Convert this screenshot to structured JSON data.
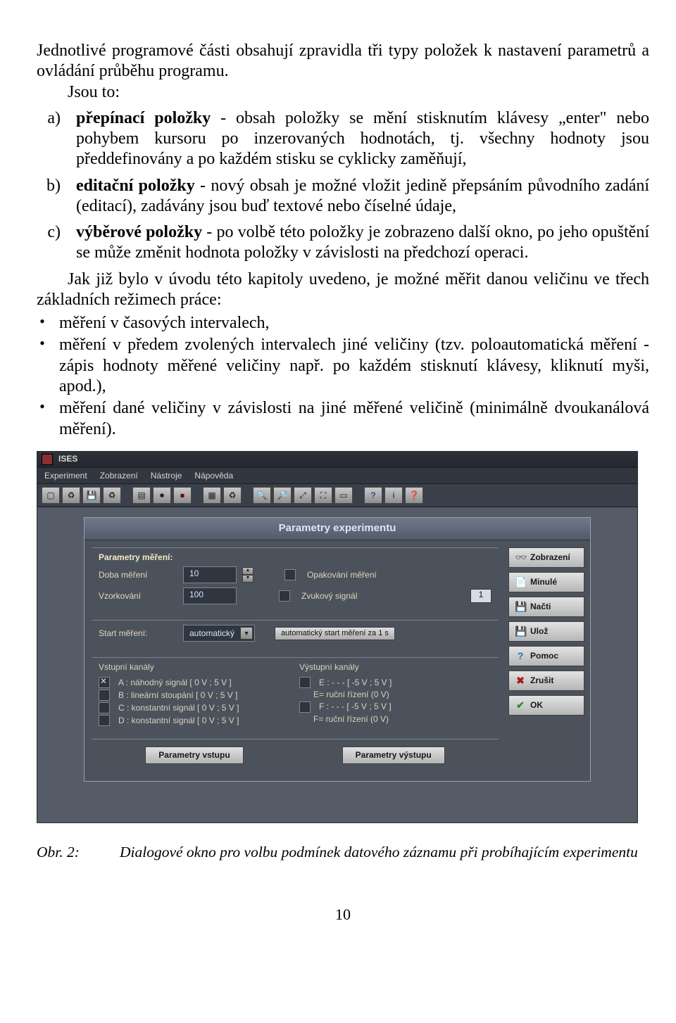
{
  "text": {
    "intro": "Jednotlivé programové části obsahují zpravidla tři typy položek k nastavení parametrů a ovládání průběhu programu.",
    "jsou_to": "Jsou to:",
    "items": [
      {
        "lbl": "a)",
        "pre": "přepínací položky",
        "post": " - obsah položky se mění stisknutím  klávesy „enter\" nebo pohybem kursoru po inzerovaných  hodnotách, tj. všechny hodnoty jsou předdefinovány a po  každém stisku se cyklicky zaměňují,"
      },
      {
        "lbl": "b)",
        "pre": "editační položky",
        "post": " - nový obsah je možné vložit jedině  přepsáním původního zadání (editací), zadávány jsou buď  textové nebo číselné údaje,"
      },
      {
        "lbl": "c)",
        "pre": "výběrové položky",
        "post": " - po volbě této položky je zobrazeno  další okno, po jeho opuštění se může změnit hodnota položky v závislosti na předchozí operaci."
      }
    ],
    "after": "Jak již bylo v úvodu této kapitoly uvedeno, je  možné měřit danou veličinu ve třech základních režimech práce:",
    "bul1": "měření v časových intervalech,",
    "bul2": "měření v předem zvolených intervalech jiné veličiny (tzv. poloautomatická měření - zápis hodnoty měřené veličiny např. po každém stisknutí klávesy, kliknutí myši, apod.),",
    "bul3": "měření dané veličiny v závislosti na jiné měřené veličině (minimálně dvoukanálová měření)."
  },
  "shot": {
    "title": "ISES",
    "menu": [
      "Experiment",
      "Zobrazení",
      "Nástroje",
      "Nápověda"
    ],
    "dlg_title": "Parametry experimentu",
    "grp1_title": "Parametry měření:",
    "doba_lbl": "Doba měření",
    "doba_val": "10",
    "vz_lbl": "Vzorkování",
    "vz_val": "100",
    "opak": "Opakování měření",
    "zvuk": "Zvukový signál",
    "count_val": "1",
    "start_lbl": "Start měření:",
    "start_val": "automatický",
    "start_info": "automatický start měření za 1 s",
    "in_title": "Vstupní kanály",
    "out_title": "Výstupní kanály",
    "in": [
      "A : náhodný signál [ 0 V ; 5 V ]",
      "B : lineární stoupání [ 0 V ; 5 V ]",
      "C : konstantní signál [ 0 V ; 5 V ]",
      "D : konstantní signál [ 0 V ; 5 V ]"
    ],
    "out": [
      "E : - - -  [ -5 V ; 5 V ]",
      "E= ruční řízení (0 V)",
      "F : - - -  [ -5 V ; 5 V ]",
      "F= ruční řízení (0 V)"
    ],
    "btn_in": "Parametry vstupu",
    "btn_out": "Parametry výstupu",
    "right": [
      "Zobrazení",
      "Minulé",
      "Načti",
      "Ulož",
      "Pomoc",
      "Zrušit",
      "OK"
    ]
  },
  "caption": {
    "lbl": "Obr. 2:",
    "text": "Dialogové okno pro volbu podmínek datového záznamu při probíhajícím experimentu"
  },
  "pagenum": "10"
}
